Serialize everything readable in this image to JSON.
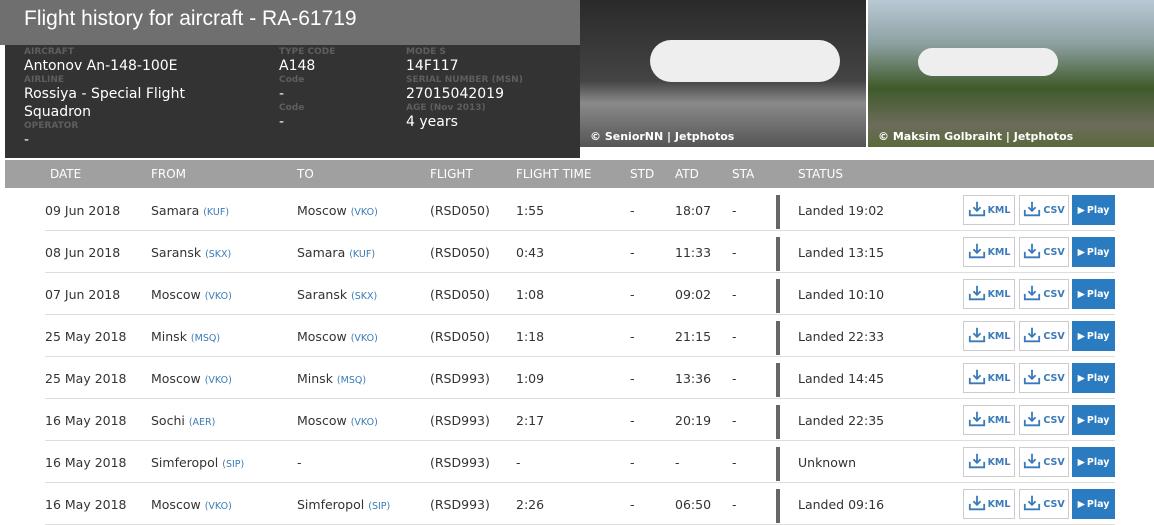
{
  "title": "Flight history for aircraft - RA-61719",
  "info": {
    "aircraft_label": "AIRCRAFT",
    "aircraft": "Antonov An-148-100E",
    "airline_label": "AIRLINE",
    "airline": "Rossiya - Special Flight Squadron",
    "operator_label": "OPERATOR",
    "operator": "-",
    "type_code_label": "TYPE CODE",
    "type_code": "A148",
    "code1_label": "Code",
    "code1": "-",
    "code2_label": "Code",
    "code2": "-",
    "mode_s_label": "MODE S",
    "mode_s": "14F117",
    "msn_label": "SERIAL NUMBER (MSN)",
    "msn": "27015042019",
    "age_label": "AGE (Nov 2013)",
    "age": "4 years"
  },
  "photos": [
    {
      "credit": "© SeniorNN | Jetphotos"
    },
    {
      "credit": "© Maksim Golbraiht | Jetphotos"
    }
  ],
  "columns": [
    "DATE",
    "FROM",
    "TO",
    "FLIGHT",
    "FLIGHT TIME",
    "STD",
    "ATD",
    "STA",
    "STATUS"
  ],
  "buttons": {
    "kml": "KML",
    "csv": "CSV",
    "play": "Play"
  },
  "rows": [
    {
      "date": "09 Jun 2018",
      "from": "Samara",
      "from_code": "(KUF)",
      "to": "Moscow",
      "to_code": "(VKO)",
      "flight": "(RSD050)",
      "time": "1:55",
      "std": "-",
      "atd": "18:07",
      "sta": "-",
      "status": "Landed 19:02"
    },
    {
      "date": "08 Jun 2018",
      "from": "Saransk",
      "from_code": "(SKX)",
      "to": "Samara",
      "to_code": "(KUF)",
      "flight": "(RSD050)",
      "time": "0:43",
      "std": "-",
      "atd": "11:33",
      "sta": "-",
      "status": "Landed 13:15"
    },
    {
      "date": "07 Jun 2018",
      "from": "Moscow",
      "from_code": "(VKO)",
      "to": "Saransk",
      "to_code": "(SKX)",
      "flight": "(RSD050)",
      "time": "1:08",
      "std": "-",
      "atd": "09:02",
      "sta": "-",
      "status": "Landed 10:10"
    },
    {
      "date": "25 May 2018",
      "from": "Minsk",
      "from_code": "(MSQ)",
      "to": "Moscow",
      "to_code": "(VKO)",
      "flight": "(RSD050)",
      "time": "1:18",
      "std": "-",
      "atd": "21:15",
      "sta": "-",
      "status": "Landed 22:33"
    },
    {
      "date": "25 May 2018",
      "from": "Moscow",
      "from_code": "(VKO)",
      "to": "Minsk",
      "to_code": "(MSQ)",
      "flight": "(RSD993)",
      "time": "1:09",
      "std": "-",
      "atd": "13:36",
      "sta": "-",
      "status": "Landed 14:45"
    },
    {
      "date": "16 May 2018",
      "from": "Sochi",
      "from_code": "(AER)",
      "to": "Moscow",
      "to_code": "(VKO)",
      "flight": "(RSD993)",
      "time": "2:17",
      "std": "-",
      "atd": "20:19",
      "sta": "-",
      "status": "Landed 22:35"
    },
    {
      "date": "16 May 2018",
      "from": "Simferopol",
      "from_code": "(SIP)",
      "to": "-",
      "to_code": "",
      "flight": "(RSD993)",
      "time": "-",
      "std": "-",
      "atd": "-",
      "sta": "-",
      "status": "Unknown"
    },
    {
      "date": "16 May 2018",
      "from": "Moscow",
      "from_code": "(VKO)",
      "to": "Simferopol",
      "to_code": "(SIP)",
      "flight": "(RSD993)",
      "time": "2:26",
      "std": "-",
      "atd": "06:50",
      "sta": "-",
      "status": "Landed 09:16"
    }
  ]
}
